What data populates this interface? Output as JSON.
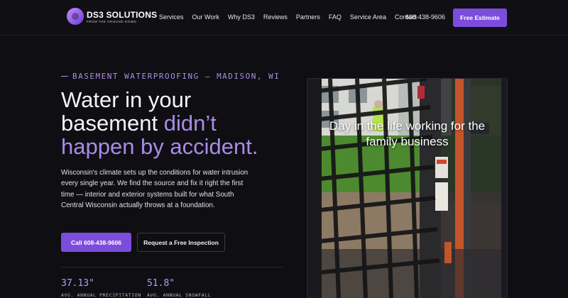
{
  "brand": {
    "name": "DS3 SOLUTIONS",
    "tagline": "FROM THE GROUND DOWN"
  },
  "nav": {
    "links": [
      "Services",
      "Our Work",
      "Why DS3",
      "Reviews",
      "Partners",
      "FAQ",
      "Service Area",
      "Contact"
    ],
    "phone": "608-438-9606",
    "cta_label": "Free Estimate"
  },
  "hero": {
    "eyebrow": "BASEMENT WATERPROOFING — MADISON, WI",
    "headline_line1": "Water in your",
    "headline_line2_plain": "basement ",
    "headline_line2_accent": "didn’t",
    "headline_line3_accent": "happen by accident.",
    "paragraph": "Wisconsin's climate sets up the conditions for water intrusion every single year. We find the source and fix it right the first time — interior and exterior systems built for what South Central Wisconsin actually throws at a foundation.",
    "call_button": "Call 608-438-9606",
    "inspect_button": "Request a Free Inspection",
    "stats": [
      {
        "value": "37.13\"",
        "label": "AVG. ANNUAL PRECIPITATION"
      },
      {
        "value": "51.8\"",
        "label": "AVG. ANNUAL SNOWFALL"
      }
    ]
  },
  "video": {
    "caption": "Day in the life working for the family business",
    "icon": "play-video"
  },
  "colors": {
    "background": "#0f0e13",
    "accent": "#7c4ddc",
    "accent_text": "#a98be8"
  }
}
